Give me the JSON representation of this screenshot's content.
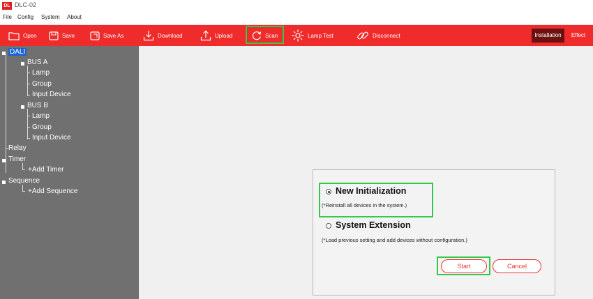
{
  "window": {
    "title": "DLC-02",
    "logo_text": "DL"
  },
  "menu": [
    "File",
    "Config",
    "System",
    "About"
  ],
  "toolbar": {
    "open": "Open",
    "save": "Save",
    "save_as": "Save As",
    "download": "Download",
    "upload": "Upload",
    "scan": "Scan",
    "lamp_test": "Lamp Test",
    "disconnect": "Disconnect"
  },
  "mode_tabs": {
    "installation": "Installation",
    "effect": "Effect",
    "active": "Installation"
  },
  "tree": {
    "dali": "DALI",
    "bus_a": "BUS A",
    "bus_a_lamp": "Lamp",
    "bus_a_group": "Group",
    "bus_a_input": "Input Device",
    "bus_b": "BUS B",
    "bus_b_lamp": "Lamp",
    "bus_b_group": "Group",
    "bus_b_input": "Input Device",
    "relay": "Relay",
    "timer": "Timer",
    "add_timer": "+Add Timer",
    "sequence": "Sequence",
    "add_sequence": "+Add Sequence"
  },
  "dialog": {
    "new_init_label": "New Initialization",
    "new_init_desc": "(*Reinstall all devices in the system.)",
    "sys_ext_label": "System Extension",
    "sys_ext_desc": "(*Load previous setting and add devices without configuration.)",
    "selected": "New Initialization",
    "start_label": "Start",
    "cancel_label": "Cancel"
  },
  "colors": {
    "toolbar": "#ef2b2b",
    "sidebar": "#707070",
    "highlight": "#35c84a",
    "selected_node": "#1e63d0"
  }
}
